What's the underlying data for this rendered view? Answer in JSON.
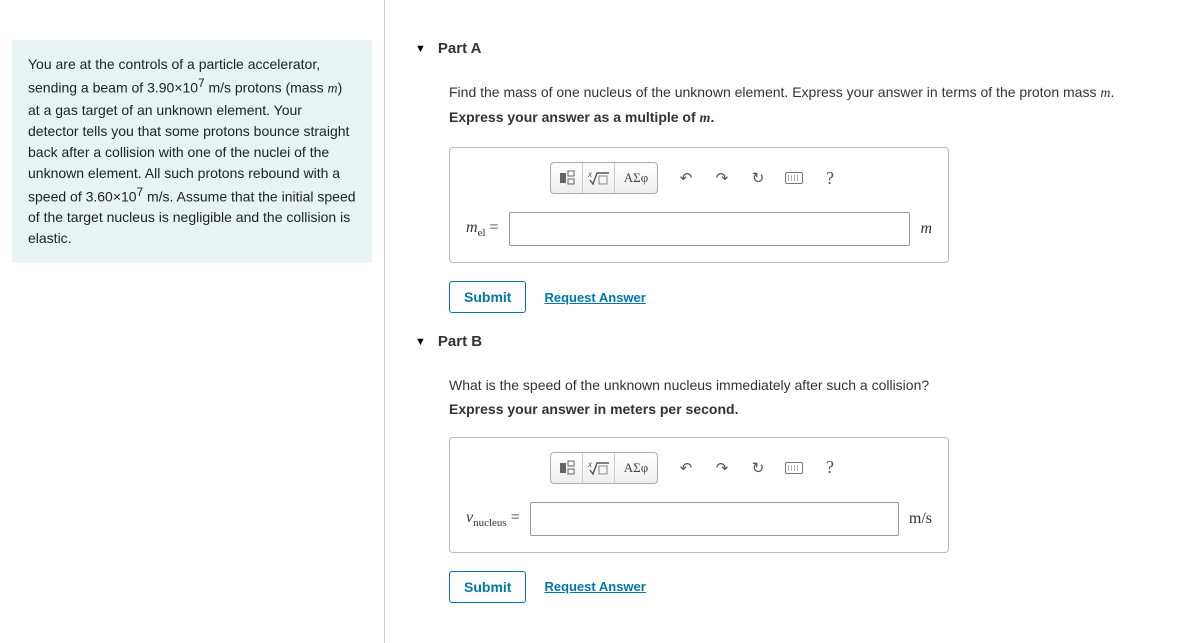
{
  "problem": {
    "text_parts": [
      "You are at the controls of a particle accelerator, sending a beam of 3.90×10",
      "7",
      " m/s protons (mass ",
      "m",
      ") at a gas target of an unknown element. Your detector tells you that some protons bounce straight back after a collision with one of the nuclei of the unknown element. All such protons rebound with a speed of 3.60×10",
      "7",
      " m/s. Assume that the initial speed of the target nucleus is negligible and the collision is elastic."
    ]
  },
  "parts": {
    "a": {
      "title": "Part A",
      "prompt_pre": "Find the mass of one nucleus of the unknown element. Express your answer in terms of the proton mass ",
      "prompt_var": "m",
      "prompt_post": ".",
      "instruction_pre": "Express your answer as a multiple of ",
      "instruction_var": "m",
      "instruction_post": ".",
      "lhs_var": "m",
      "lhs_sub": "el",
      "equals": " = ",
      "unit": "m",
      "submit": "Submit",
      "request": "Request Answer"
    },
    "b": {
      "title": "Part B",
      "prompt": "What is the speed of the unknown nucleus immediately after such a collision?",
      "instruction": "Express your answer in meters per second.",
      "lhs_var": "v",
      "lhs_sub": "nucleus",
      "equals": " = ",
      "unit": "m/s",
      "submit": "Submit",
      "request": "Request Answer"
    }
  },
  "toolbar": {
    "templates": "templates-icon",
    "sqrt": "sqrt-icon",
    "greek": "ΑΣφ",
    "undo": "↶",
    "redo": "↷",
    "reset": "↻",
    "keyboard": "keyboard-icon",
    "help": "?"
  }
}
